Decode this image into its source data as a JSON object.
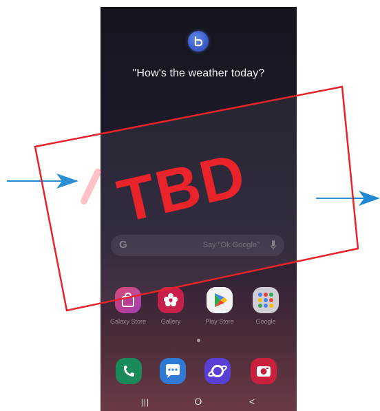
{
  "screen": {
    "query_text": "\"How's the weather today?",
    "search_bar": {
      "google_letter": "G",
      "placeholder": "Say \"Ok Google\""
    },
    "apps": [
      {
        "label": "Galaxy Store",
        "icon": "galaxy-store-icon"
      },
      {
        "label": "Gallery",
        "icon": "gallery-icon"
      },
      {
        "label": "Play Store",
        "icon": "play-store-icon"
      },
      {
        "label": "Google",
        "icon": "google-folder-icon"
      }
    ],
    "dock": [
      {
        "icon": "phone-icon"
      },
      {
        "icon": "messages-icon"
      },
      {
        "icon": "internet-icon"
      },
      {
        "icon": "camera-icon"
      }
    ],
    "nav": {
      "recents": "|||",
      "home": "O",
      "back": "<"
    }
  },
  "overlay": {
    "stamp_text": "TBD",
    "stamp_color": "#e8232a",
    "arrow_color": "#1e88d2"
  }
}
